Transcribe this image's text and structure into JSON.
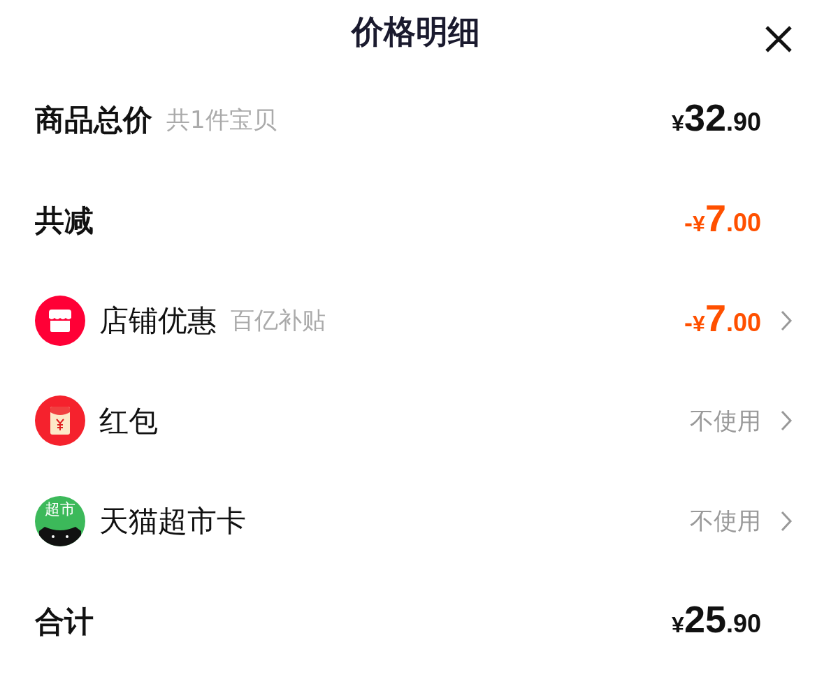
{
  "title": "价格明细",
  "rows": [
    {
      "kind": "summary",
      "label": "商品总价",
      "note": "共1件宝贝",
      "price": {
        "currency": "¥",
        "integer": "32",
        "decimal": ".90"
      },
      "highlight": false
    },
    {
      "kind": "summary",
      "label": "共减",
      "price": {
        "sign": "-",
        "currency": "¥",
        "integer": "7",
        "decimal": ".00"
      },
      "highlight": true
    },
    {
      "kind": "shop",
      "label": "店铺优惠",
      "note": "百亿补贴",
      "price": {
        "sign": "-",
        "currency": "¥",
        "integer": "7",
        "decimal": ".00"
      },
      "highlight": true
    },
    {
      "kind": "envelope",
      "label": "红包",
      "value": "不使用"
    },
    {
      "kind": "market",
      "icon_text": "超市",
      "label": "天猫超市卡",
      "value": "不使用"
    },
    {
      "kind": "summary",
      "label": "合计",
      "price": {
        "currency": "¥",
        "integer": "25",
        "decimal": ".90"
      },
      "highlight": false
    }
  ]
}
